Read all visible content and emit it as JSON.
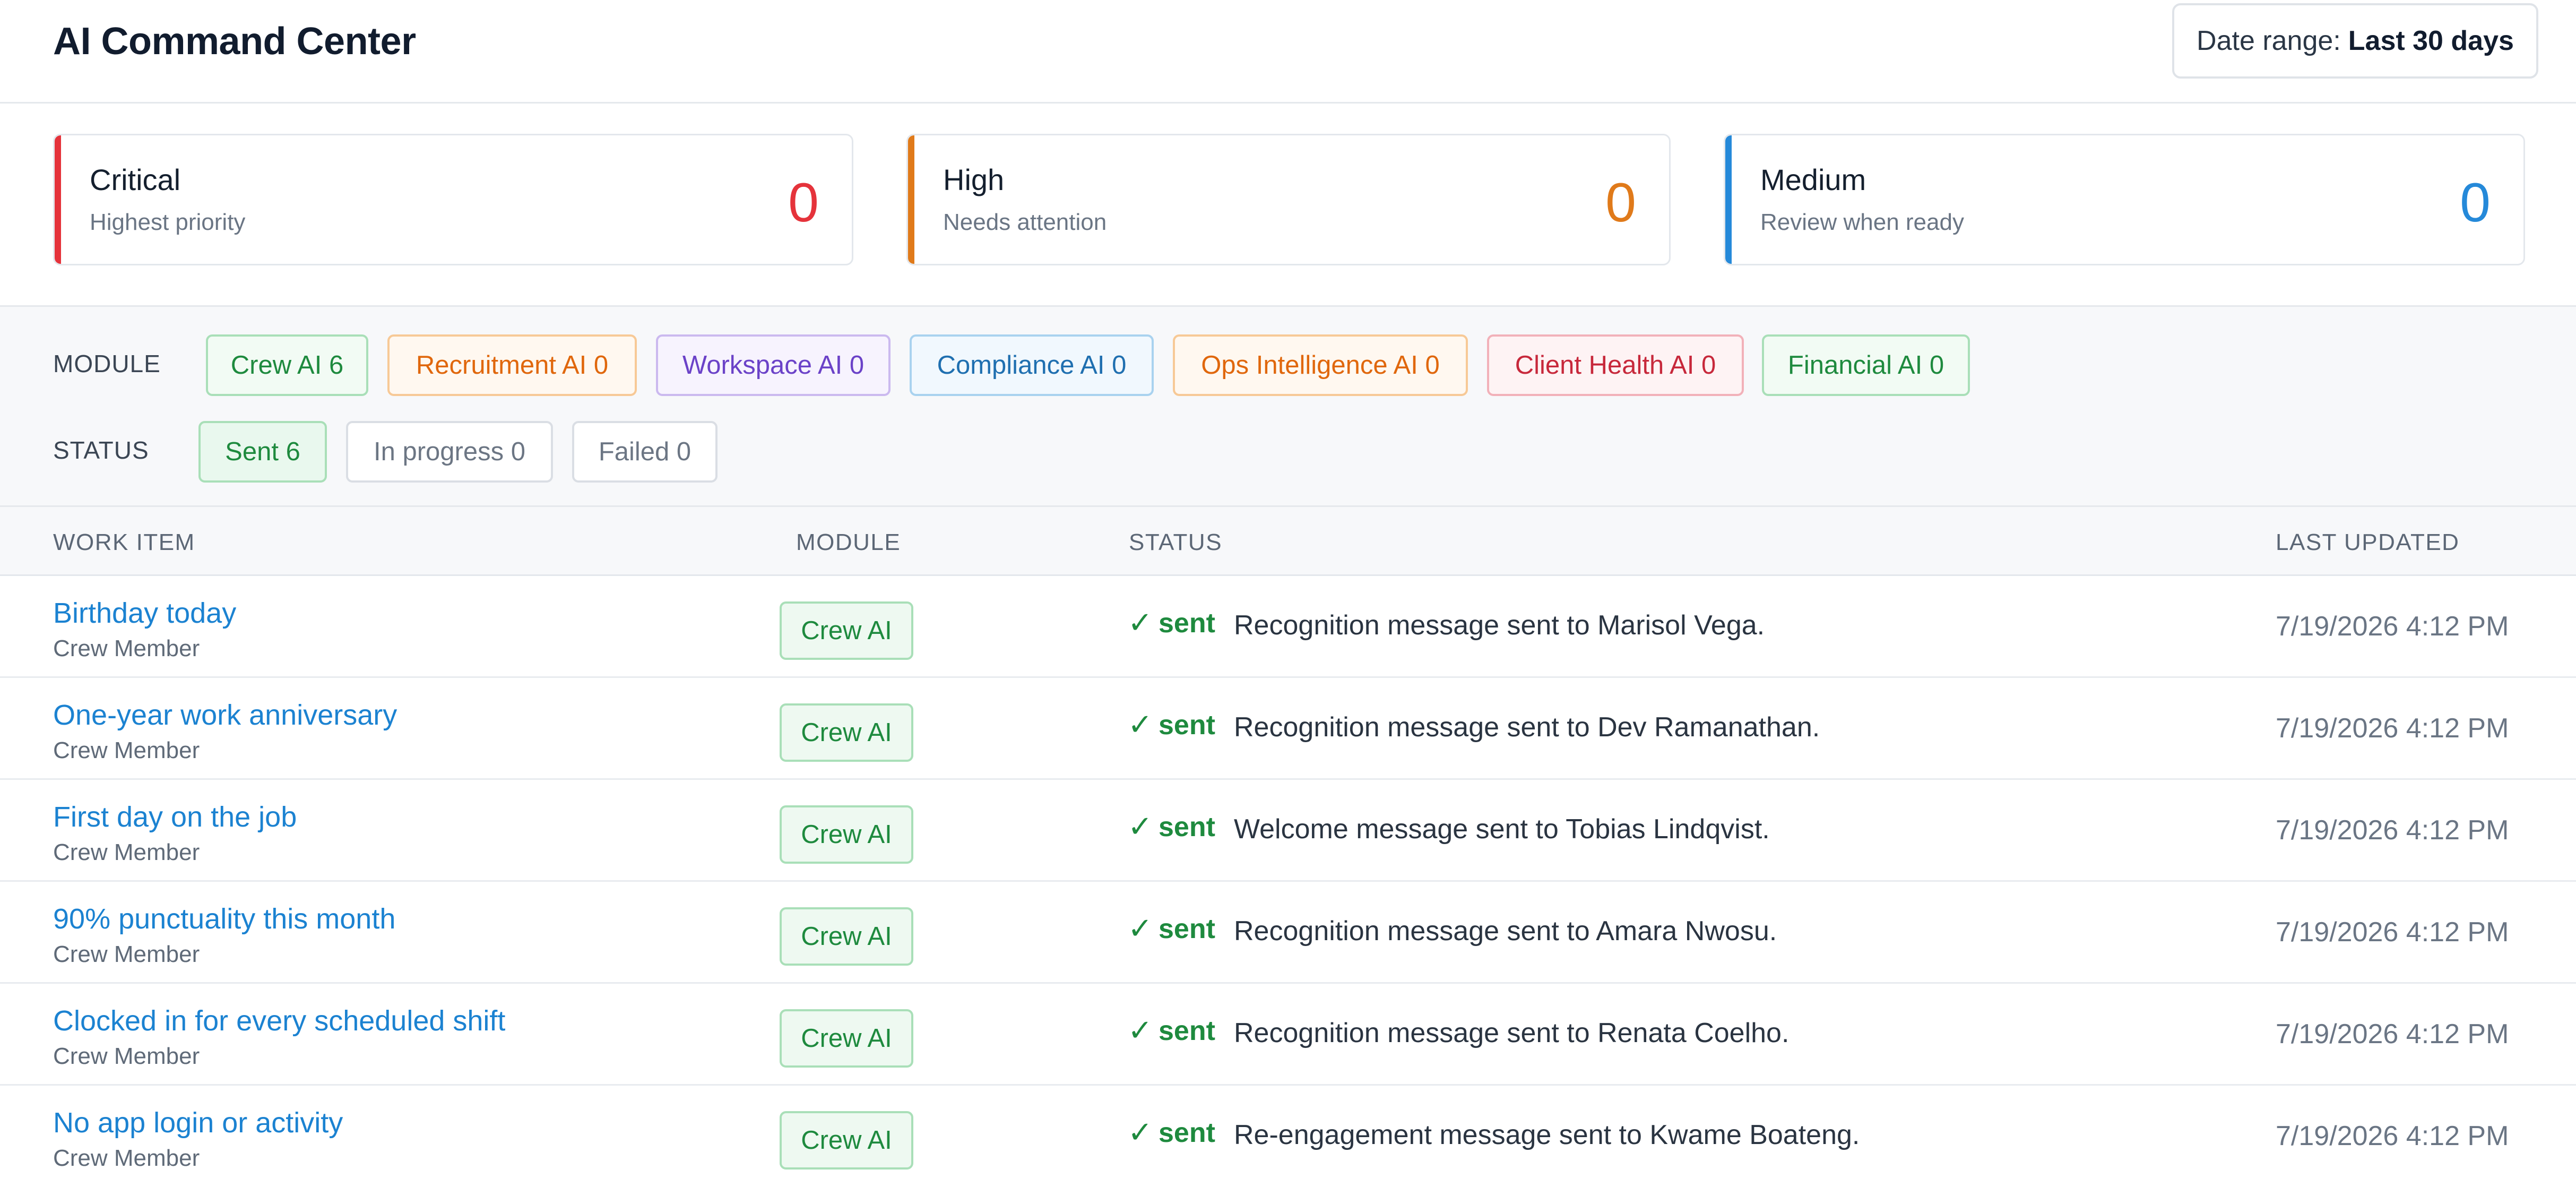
{
  "header": {
    "title": "AI Command Center",
    "date_range_label": "Date range:",
    "date_range_value": "Last 30 days"
  },
  "priority_cards": [
    {
      "title": "Critical",
      "subtitle": "Highest priority",
      "count": "0",
      "color": "#e5333b"
    },
    {
      "title": "High",
      "subtitle": "Needs attention",
      "count": "0",
      "color": "#e07a1a"
    },
    {
      "title": "Medium",
      "subtitle": "Review when ready",
      "count": "0",
      "color": "#2589d9"
    }
  ],
  "filters": {
    "module_label": "MODULE",
    "status_label": "STATUS",
    "modules": [
      {
        "label": "Crew AI 6",
        "color": "green"
      },
      {
        "label": "Recruitment AI 0",
        "color": "orange"
      },
      {
        "label": "Workspace AI 0",
        "color": "purple"
      },
      {
        "label": "Compliance AI 0",
        "color": "blue"
      },
      {
        "label": "Ops Intelligence AI 0",
        "color": "orange"
      },
      {
        "label": "Client Health AI 0",
        "color": "red"
      },
      {
        "label": "Financial AI 0",
        "color": "green"
      }
    ],
    "statuses": [
      {
        "label": "Sent 6",
        "active": true
      },
      {
        "label": "In progress 0",
        "active": false
      },
      {
        "label": "Failed 0",
        "active": false
      }
    ]
  },
  "table": {
    "columns": [
      "WORK ITEM",
      "MODULE",
      "STATUS",
      "LAST UPDATED"
    ],
    "rows": [
      {
        "title": "Birthday today",
        "subtitle": "Crew Member",
        "module": "Crew AI",
        "check": "✓",
        "status": "sent",
        "message": "Recognition message sent to Marisol Vega.",
        "updated": "7/19/2026 4:12 PM"
      },
      {
        "title": "One-year work anniversary",
        "subtitle": "Crew Member",
        "module": "Crew AI",
        "check": "✓",
        "status": "sent",
        "message": "Recognition message sent to Dev Ramanathan.",
        "updated": "7/19/2026 4:12 PM"
      },
      {
        "title": "First day on the job",
        "subtitle": "Crew Member",
        "module": "Crew AI",
        "check": "✓",
        "status": "sent",
        "message": "Welcome message sent to Tobias Lindqvist.",
        "updated": "7/19/2026 4:12 PM"
      },
      {
        "title": "90% punctuality this month",
        "subtitle": "Crew Member",
        "module": "Crew AI",
        "check": "✓",
        "status": "sent",
        "message": "Recognition message sent to Amara Nwosu.",
        "updated": "7/19/2026 4:12 PM"
      },
      {
        "title": "Clocked in for every scheduled shift",
        "subtitle": "Crew Member",
        "module": "Crew AI",
        "check": "✓",
        "status": "sent",
        "message": "Recognition message sent to Renata Coelho.",
        "updated": "7/19/2026 4:12 PM"
      },
      {
        "title": "No app login or activity",
        "subtitle": "Crew Member",
        "module": "Crew AI",
        "check": "✓",
        "status": "sent",
        "message": "Re-engagement message sent to Kwame Boateng.",
        "updated": "7/19/2026 4:12 PM"
      }
    ]
  }
}
